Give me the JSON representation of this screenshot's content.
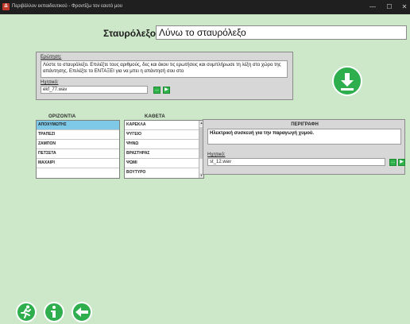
{
  "window": {
    "title": "Περιβάλλον εκπαιδευτικού - Φροντίζω τον εαυτό μου",
    "minimize": "—",
    "maximize": "☐",
    "close": "✕"
  },
  "crossword": {
    "label": "Σταυρόλεξο:",
    "value": "Λύνω το σταυρόλεξο"
  },
  "question": {
    "label": "Ερώτηση:",
    "text": "Λύστε το σταυρόλεξο. Επιλέξτε τους αριθμούς, δες και άκου τις ερωτήσεις και συμπλήρωσε τη λέξη στο χώρο της απάντησης. Επιλέξτε το ΕΝΤΑΞΕΙ για να μπει η απάντησή σου στο",
    "audio_label": "Ηχητικό:",
    "audio_file": "ekf_77.wav"
  },
  "horizontal": {
    "header": "ΟΡΙΖΟΝΤΙΑ",
    "items": [
      "ΑΠΟΧΥΜΩΤΗΣ",
      "ΤΡΑΠΕΖΙ",
      "ΖΑΜΠΟΝ",
      "ΠΕΤΣΕΤΑ",
      "ΜΑΧΑΙΡΙ",
      ""
    ]
  },
  "vertical": {
    "header": "ΚΑΘΕΤΑ",
    "items": [
      "ΚΑΡΕΚΛΑ",
      "ΨΥΓΕΙΟ",
      "ΨΗΝΩ",
      "ΒΡΑΣΤΗΡΑΣ",
      "ΨΩΜΙ",
      "ΒΟΥΤΥΡΟ"
    ]
  },
  "description": {
    "header": "ΠΕΡΙΓΡΑΦΗ",
    "text": "Ηλεκτρική συσκευή για την παραγωγή χυμού.",
    "audio_label": "Ηχητικό:",
    "audio_file": "st_12.wav"
  },
  "buttons": {
    "browse": "...",
    "play": "▶"
  },
  "colors": {
    "background": "#cde8c8",
    "accent_green": "#2fae4e",
    "selected_row": "#7ec8e8"
  },
  "icons": {
    "download": "download-icon",
    "exit": "running-exit-icon",
    "info": "info-icon",
    "back": "arrow-left-icon"
  }
}
